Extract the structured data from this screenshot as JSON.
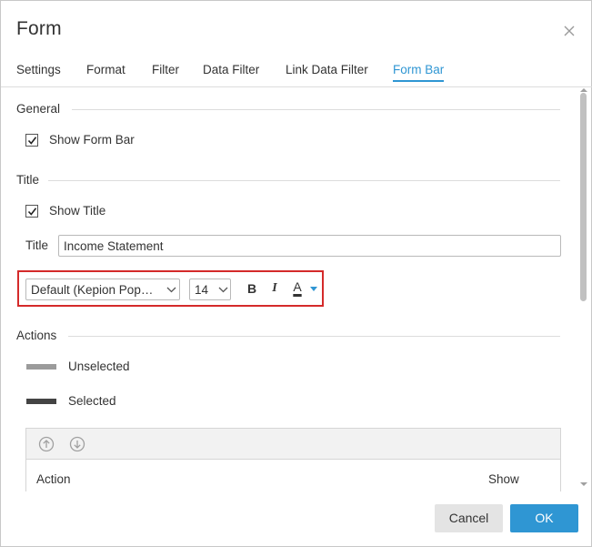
{
  "dialog": {
    "title": "Form"
  },
  "tabs": [
    {
      "label": "Settings"
    },
    {
      "label": "Format"
    },
    {
      "label": "Filter"
    },
    {
      "label": "Data Filter"
    },
    {
      "label": "Link Data Filter"
    },
    {
      "label": "Form Bar",
      "active": true
    }
  ],
  "general": {
    "heading": "General",
    "show_form_bar": {
      "label": "Show Form Bar",
      "checked": true
    }
  },
  "title_section": {
    "heading": "Title",
    "show_title": {
      "label": "Show Title",
      "checked": true
    },
    "title_label": "Title",
    "title_value": "Income Statement",
    "font_family": "Default (Kepion Pop…",
    "font_size": "14",
    "bold_label": "B",
    "italic_label": "I",
    "font_color_label": "A"
  },
  "actions": {
    "heading": "Actions",
    "unselected_label": "Unselected",
    "selected_label": "Selected",
    "unselected_color": "#9b9b9b",
    "selected_color": "#444444",
    "columns": [
      "Action",
      "Show"
    ]
  },
  "footer": {
    "cancel_label": "Cancel",
    "ok_label": "OK"
  },
  "colors": {
    "accent": "#2f96d3",
    "highlight_border": "#d42a2a"
  }
}
